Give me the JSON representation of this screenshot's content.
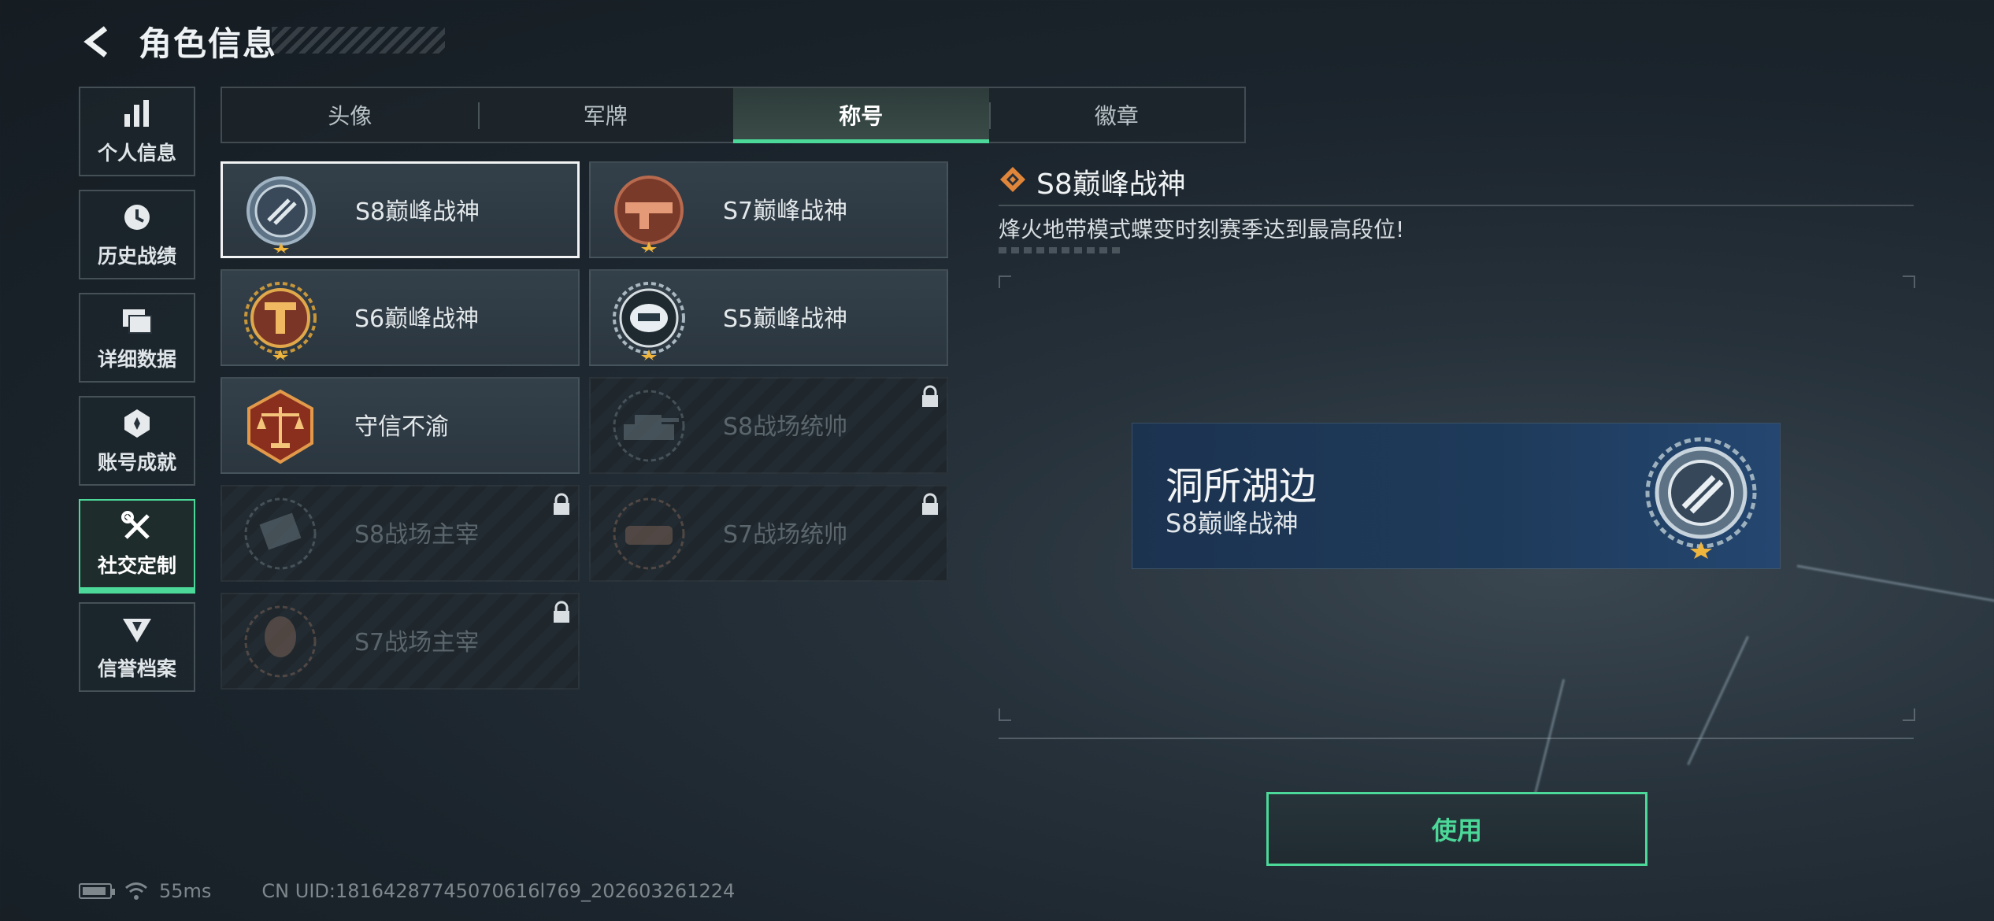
{
  "header": {
    "title": "角色信息"
  },
  "nav": {
    "items": [
      {
        "label": "个人信息",
        "icon": "bar-chart-icon"
      },
      {
        "label": "历史战绩",
        "icon": "clock-icon"
      },
      {
        "label": "详细数据",
        "icon": "folder-icon"
      },
      {
        "label": "账号成就",
        "icon": "achievement-icon"
      },
      {
        "label": "社交定制",
        "icon": "tools-icon"
      },
      {
        "label": "信誉档案",
        "icon": "reputation-icon"
      }
    ],
    "active_index": 4
  },
  "tabs": [
    "头像",
    "军牌",
    "称号",
    "徽章"
  ],
  "active_tab": 2,
  "titles": [
    {
      "name": "S8巅峰战神",
      "locked": false,
      "selected": true
    },
    {
      "name": "S7巅峰战神",
      "locked": false
    },
    {
      "name": "S6巅峰战神",
      "locked": false
    },
    {
      "name": "S5巅峰战神",
      "locked": false
    },
    {
      "name": "守信不渝",
      "locked": false
    },
    {
      "name": "S8战场统帅",
      "locked": true
    },
    {
      "name": "S8战场主宰",
      "locked": true
    },
    {
      "name": "S7战场统帅",
      "locked": true
    },
    {
      "name": "S7战场主宰",
      "locked": true
    }
  ],
  "detail": {
    "title": "S8巅峰战神",
    "description": "烽火地带模式蝶变时刻赛季达到最高段位!"
  },
  "preview": {
    "player_name": "洞所湖边",
    "title": "S8巅峰战神"
  },
  "use_button": "使用",
  "status": {
    "ping": "55ms",
    "uid": "CN UID:18164287745070616l769_202603261224"
  },
  "colors": {
    "accent": "#4bd898",
    "background": "#1b242c"
  }
}
